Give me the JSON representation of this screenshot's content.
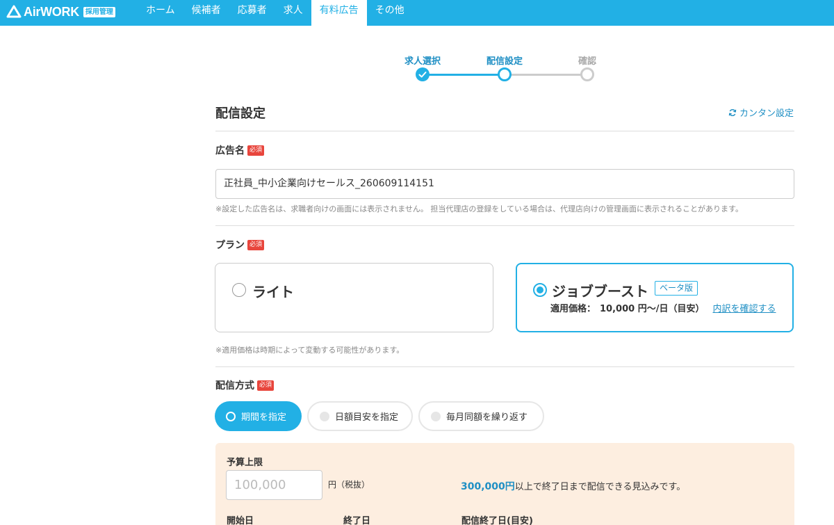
{
  "header": {
    "logo_text": "AirWORK",
    "logo_badge": "採用管理",
    "nav": [
      "ホーム",
      "候補者",
      "応募者",
      "求人",
      "有料広告",
      "その他"
    ],
    "active_nav": "有料広告",
    "brand_color": "#22b0e5"
  },
  "stepper": {
    "steps": [
      {
        "label": "求人選択",
        "state": "done"
      },
      {
        "label": "配信設定",
        "state": "current"
      },
      {
        "label": "確認",
        "state": "todo"
      }
    ]
  },
  "section": {
    "title": "配信設定",
    "easy_setting_link": "カンタン設定",
    "easy_setting_icon": "refresh-icon"
  },
  "ad_name": {
    "label": "広告名",
    "required": "必須",
    "value": "正社員_中小企業向けセールス_260609114151",
    "note": "※設定した広告名は、求職者向けの画面には表示されません。 担当代理店の登録をしている場合は、代理店向けの管理画面に表示されることがあります。"
  },
  "plan": {
    "label": "プラン",
    "required": "必須",
    "options": [
      {
        "name": "ライト",
        "selected": false
      },
      {
        "name": "ジョブブースト",
        "selected": true,
        "badge": "ベータ版",
        "price_label": "適用価格：",
        "price": "10,000 円〜/日（目安）",
        "link": "内訳を確認する"
      }
    ],
    "note": "※適用価格は時期によって変動する可能性があります。"
  },
  "delivery": {
    "label": "配信方式",
    "required": "必須",
    "options": [
      {
        "label": "期間を指定",
        "selected": true
      },
      {
        "label": "日額目安を指定",
        "selected": false
      },
      {
        "label": "毎月同額を繰り返す",
        "selected": false
      }
    ]
  },
  "budget": {
    "label": "予算上限",
    "placeholder": "100,000",
    "unit": "円（税抜）",
    "estimate_amount": "300,000円",
    "estimate_text": "以上で終了日まで配信できる見込みです。",
    "start_label": "開始日",
    "end_label": "終了日",
    "estimated_end_label": "配信終了日(目安)"
  }
}
